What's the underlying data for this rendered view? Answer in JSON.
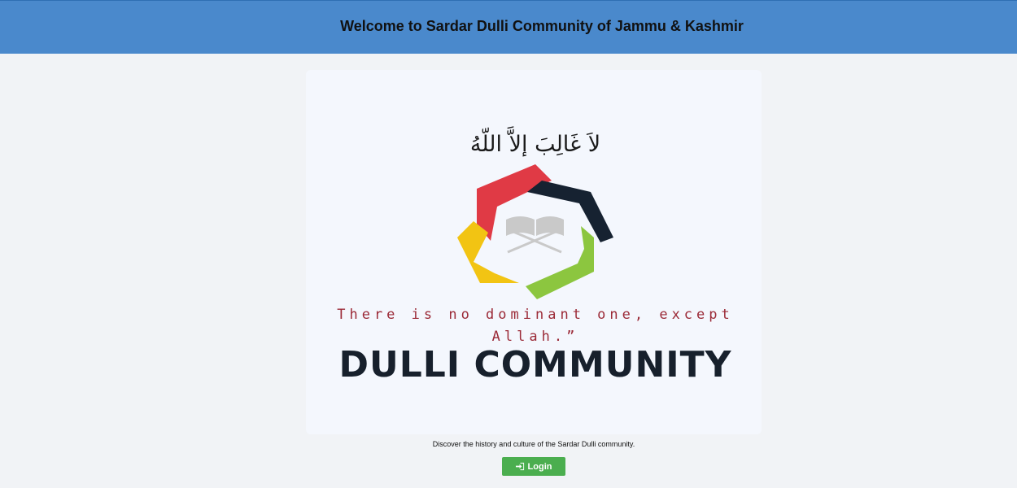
{
  "header": {
    "title": "Welcome to Sardar Dulli Community of Jammu & Kashmir",
    "background_color": "#4a89cc"
  },
  "logo": {
    "arabic_text": "لاَ غَالِبَ إلاَّ اللّهُ",
    "tagline_line1": "There is no dominant one, except",
    "tagline_line2": "Allah.”",
    "name": "DULLI COMMUNITY",
    "colors": {
      "red": "#e03a45",
      "navy": "#162231",
      "yellow": "#f2c413",
      "green": "#8cc63f",
      "book": "#c9c9c9"
    },
    "icon": "quran-book-icon"
  },
  "main": {
    "description": "Discover the history and culture of the Sardar Dulli community.",
    "login_label": "Login",
    "login_icon": "sign-in-icon",
    "login_color": "#4bae4f"
  }
}
